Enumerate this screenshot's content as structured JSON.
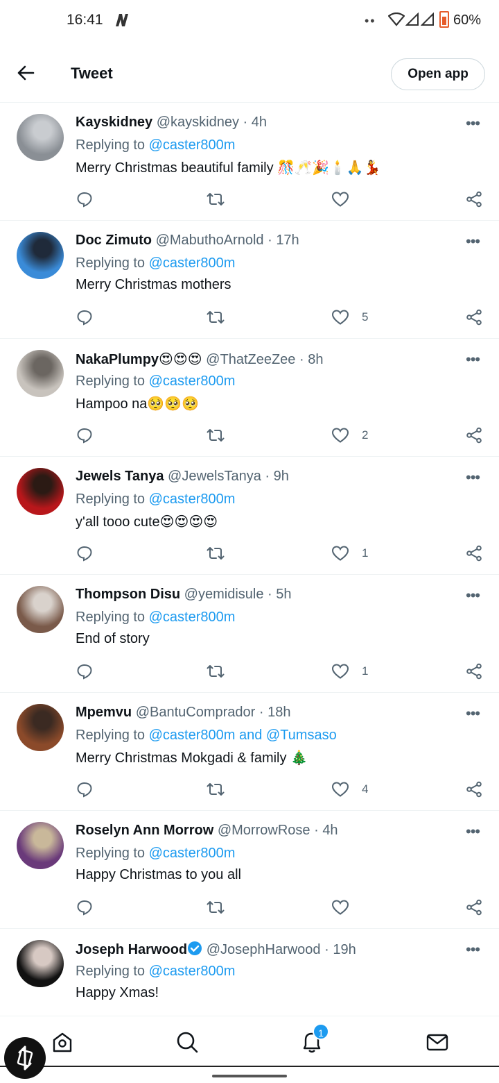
{
  "status_bar": {
    "time": "16:41",
    "battery": "60%",
    "dots": "••"
  },
  "header": {
    "title": "Tweet",
    "open_app": "Open app"
  },
  "colors": {
    "link": "#1d9bf0",
    "secondary_text": "#536471",
    "battery": "#e65c2b"
  },
  "replies": [
    {
      "name": "Kayskidney",
      "handle": "@kayskidney",
      "time": "4h",
      "replying_label": "Replying to",
      "replying_to": "@caster800m",
      "text": "Merry Christmas beautiful family 🎊🥂🎉🕯️🙏💃",
      "likes": ""
    },
    {
      "name": "Doc Zimuto",
      "handle": "@MabuthoArnold",
      "time": "17h",
      "replying_label": "Replying to",
      "replying_to": "@caster800m",
      "text": "Merry Christmas mothers",
      "likes": "5"
    },
    {
      "name": "NakaPlumpy😍😍😍",
      "handle": "@ThatZeeZee",
      "time": "8h",
      "replying_label": "Replying to",
      "replying_to": "@caster800m",
      "text": "Hampoo na🥺🥺🥺",
      "likes": "2"
    },
    {
      "name": "Jewels Tanya",
      "handle": "@JewelsTanya",
      "time": "9h",
      "replying_label": "Replying to",
      "replying_to": "@caster800m",
      "text": "y'all tooo cute😍😍😍😍",
      "likes": "1"
    },
    {
      "name": "Thompson Disu",
      "handle": "@yemidisule",
      "time": "5h",
      "replying_label": "Replying to",
      "replying_to": "@caster800m",
      "text": "End of story",
      "likes": "1"
    },
    {
      "name": "Mpemvu",
      "handle": "@BantuComprador",
      "time": "18h",
      "replying_label": "Replying to",
      "replying_to": "@caster800m and @Tumsaso",
      "text": "Merry Christmas Mokgadi & family 🎄",
      "likes": "4"
    },
    {
      "name": "Roselyn Ann Morrow",
      "handle": "@MorrowRose",
      "time": "4h",
      "replying_label": "Replying to",
      "replying_to": "@caster800m",
      "text": "Happy Christmas to you all",
      "likes": ""
    },
    {
      "name": "Joseph Harwood",
      "handle": "@JosephHarwood",
      "time": "19h",
      "replying_label": "Replying to",
      "replying_to": "@caster800m",
      "text": "Happy Xmas!",
      "likes": ""
    }
  ],
  "bottom_nav": {
    "notification_badge": "1"
  }
}
